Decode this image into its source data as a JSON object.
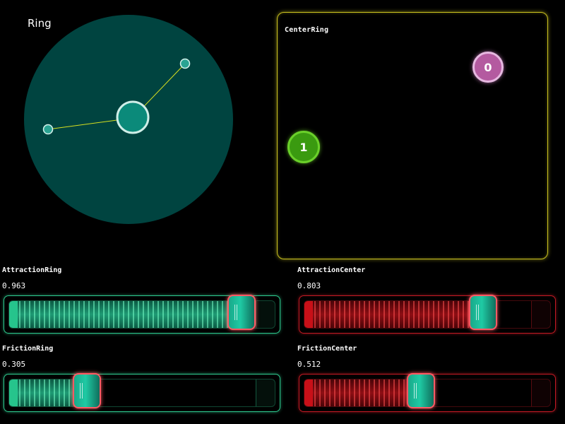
{
  "ring": {
    "title": "Ring"
  },
  "center_ring": {
    "title": "CenterRing",
    "nodes": [
      {
        "label": "0",
        "color": "#b45aa0"
      },
      {
        "label": "1",
        "color": "#3a9a10"
      }
    ]
  },
  "sliders": {
    "attraction_ring": {
      "label": "AttractionRing",
      "value_text": "0.963",
      "value": 0.963
    },
    "attraction_center": {
      "label": "AttractionCenter",
      "value_text": "0.803",
      "value": 0.803
    },
    "friction_ring": {
      "label": "FrictionRing",
      "value_text": "0.305",
      "value": 0.305
    },
    "friction_center": {
      "label": "FrictionCenter",
      "value_text": "0.512",
      "value": 0.512
    }
  },
  "colors": {
    "ring_fill": "#004440",
    "link": "#d8e020",
    "panel_border": "#c8c020",
    "green_accent": "#2ec98e",
    "red_accent": "#c41a24",
    "thumb_border": "#ff5a64"
  }
}
